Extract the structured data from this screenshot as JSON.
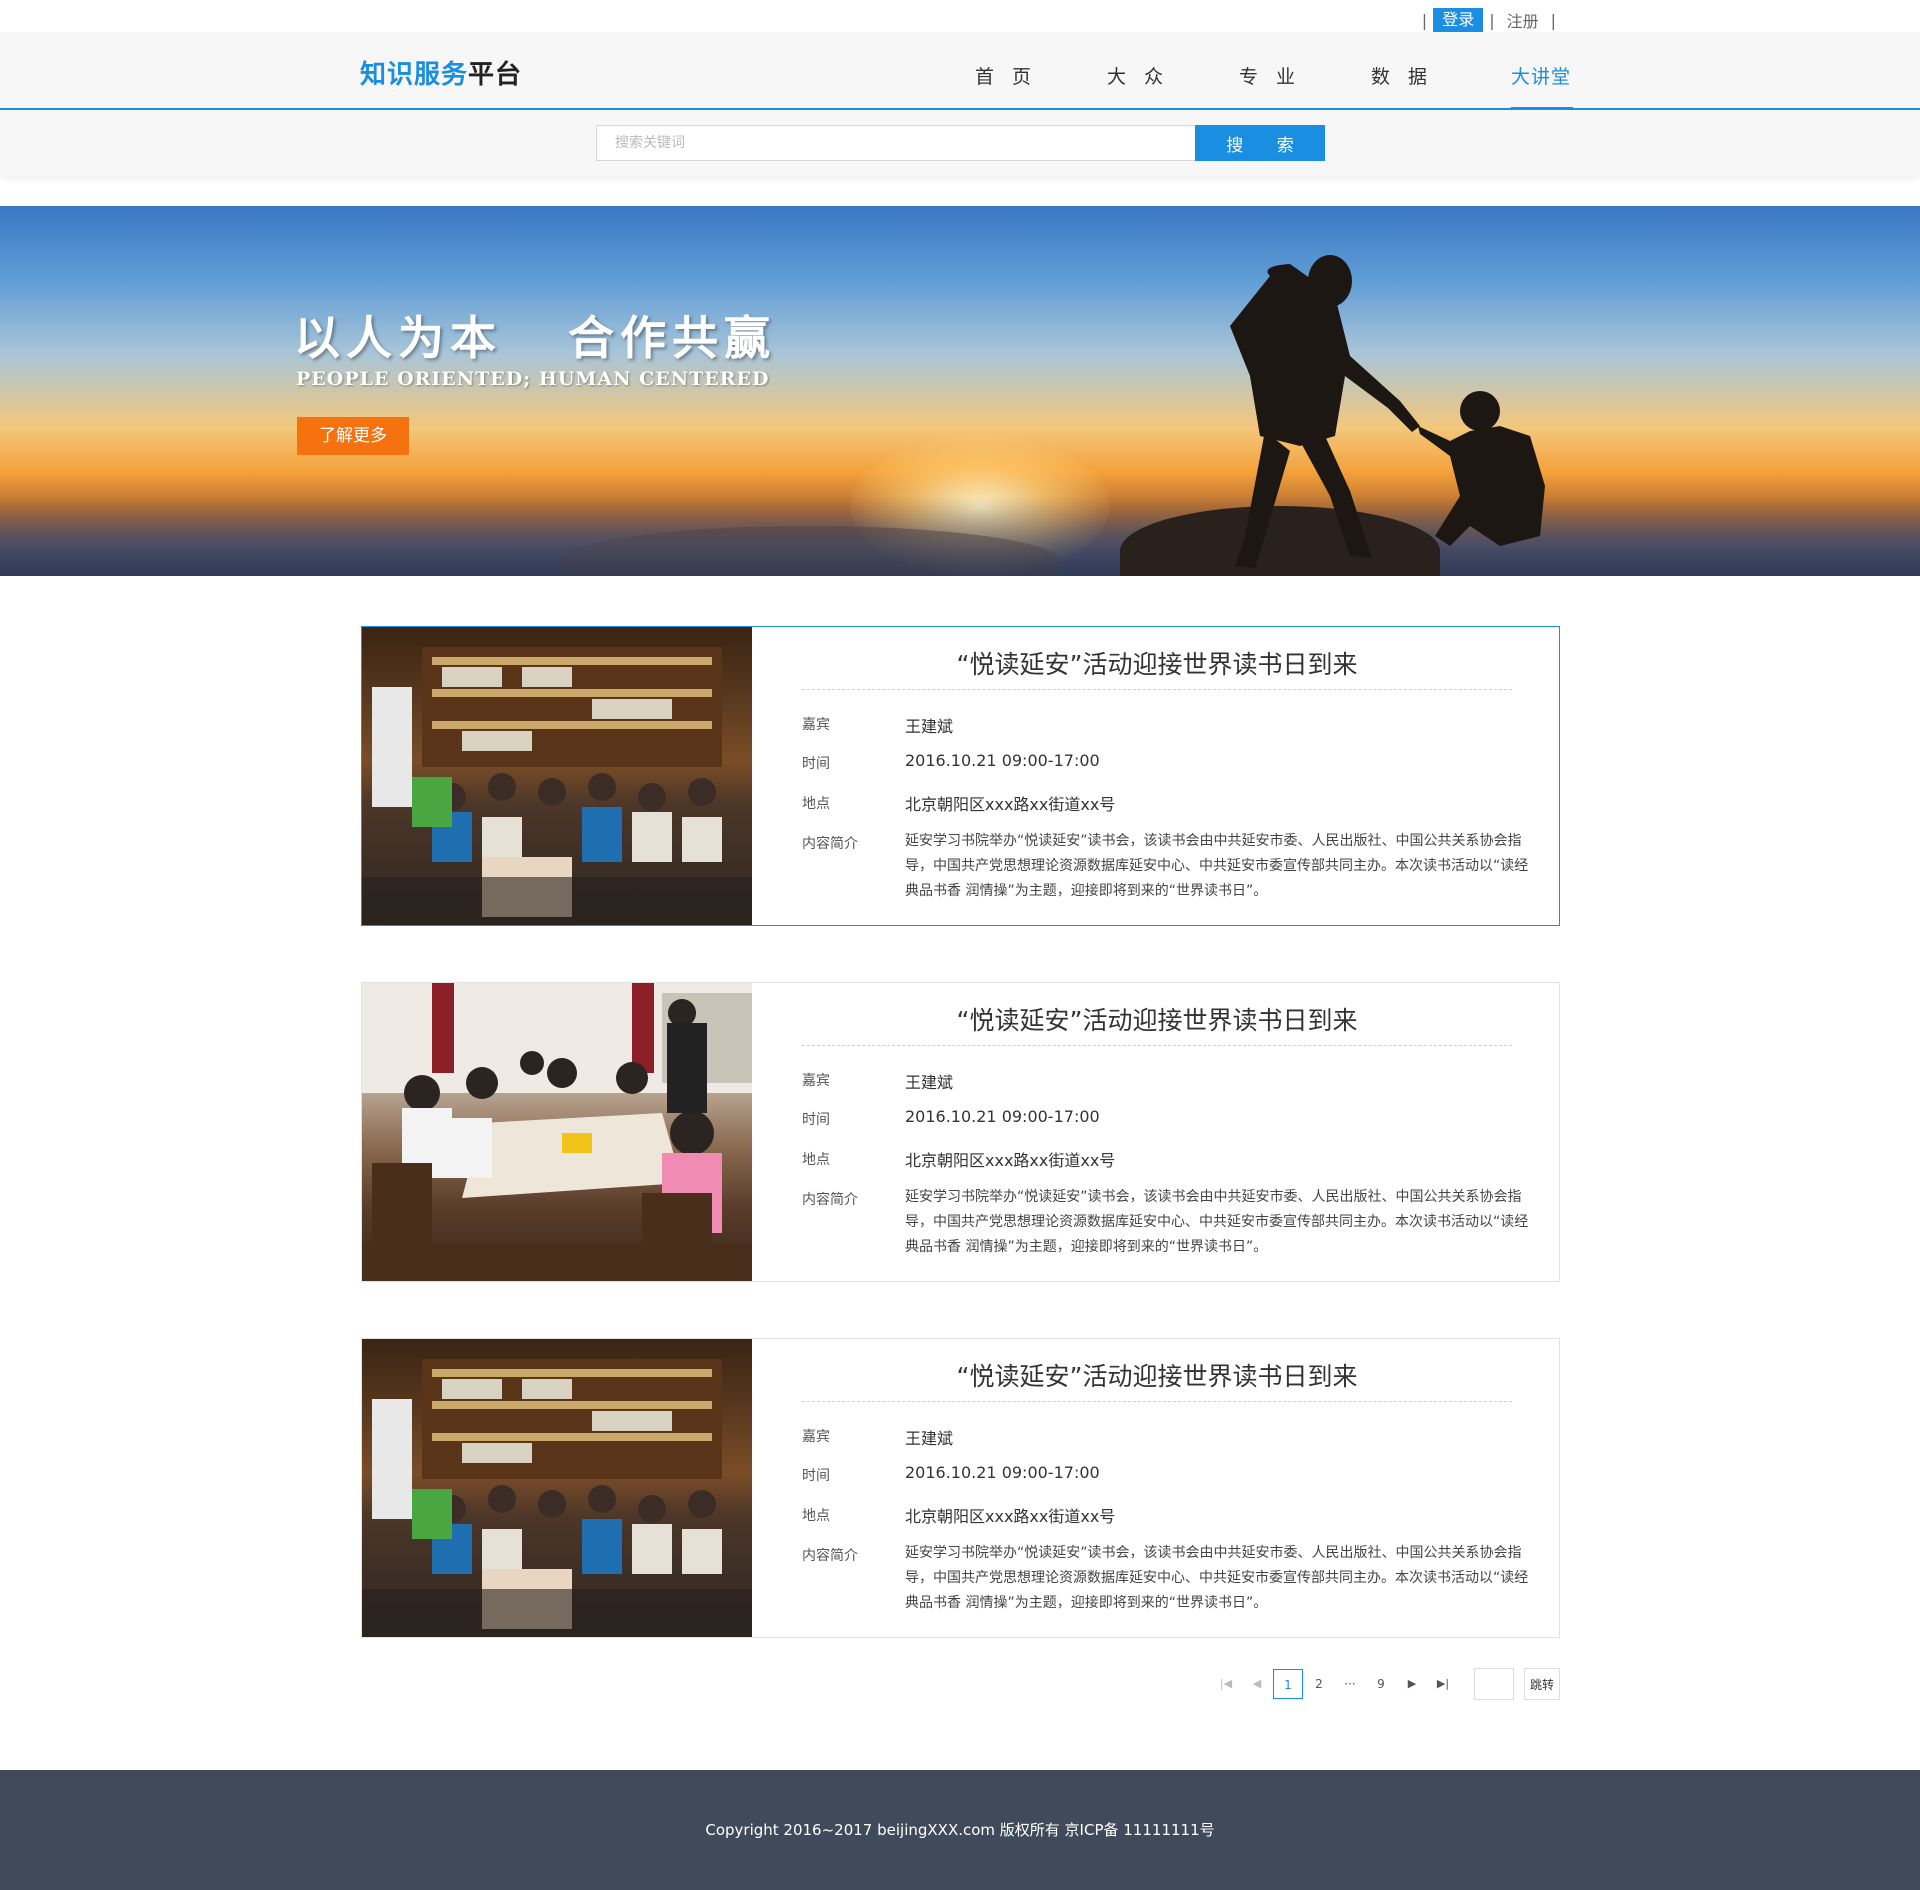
{
  "topbar": {
    "login": "登录",
    "register": "注册"
  },
  "header": {
    "logo_part1": "知识服务",
    "logo_part2": "平台",
    "nav": [
      {
        "label": "首页",
        "active": false
      },
      {
        "label": "大众",
        "active": false
      },
      {
        "label": "专业",
        "active": false
      },
      {
        "label": "数据",
        "active": false
      },
      {
        "label": "大讲堂",
        "active": true
      }
    ]
  },
  "search": {
    "placeholder": "搜索关键词",
    "button": "搜 索"
  },
  "banner": {
    "headline": "以人为本   合作共赢",
    "subline": "PEOPLE ORIENTED; HUMAN CENTERED",
    "button": "了解更多"
  },
  "events": [
    {
      "title": "“悦读延安”活动迎接世界读书日到来",
      "guest_label": "嘉宾",
      "guest": "王建斌",
      "time_label": "时间",
      "time": "2016.10.21   09:00-17:00",
      "place_label": "地点",
      "place": "北京朝阳区xxx路xx街道xx号",
      "intro_label": "内容简介",
      "intro": "延安学习书院举办“悦读延安”读书会，该读书会由中共延安市委、人民出版社、中国公共关系协会指导，中国共产党思想理论资源数据库延安中心、中共延安市委宣传部共同主办。本次读书活动以“读经典品书香 润情操”为主题，迎接即将到来的“世界读书日”。",
      "photo": "reading-session-bookshelf"
    },
    {
      "title": "“悦读延安”活动迎接世界读书日到来",
      "guest_label": "嘉宾",
      "guest": "王建斌",
      "time_label": "时间",
      "time": "2016.10.21   09:00-17:00",
      "place_label": "地点",
      "place": "北京朝阳区xxx路xx街道xx号",
      "intro_label": "内容简介",
      "intro": "延安学习书院举办“悦读延安”读书会，该读书会由中共延安市委、人民出版社、中国公共关系协会指导，中国共产党思想理论资源数据库延安中心、中共延安市委宣传部共同主办。本次读书活动以“读经典品书香 润情操”为主题，迎接即将到来的“世界读书日”。",
      "photo": "children-reading-table"
    },
    {
      "title": "“悦读延安”活动迎接世界读书日到来",
      "guest_label": "嘉宾",
      "guest": "王建斌",
      "time_label": "时间",
      "time": "2016.10.21   09:00-17:00",
      "place_label": "地点",
      "place": "北京朝阳区xxx路xx街道xx号",
      "intro_label": "内容简介",
      "intro": "延安学习书院举办“悦读延安”读书会，该读书会由中共延安市委、人民出版社、中国公共关系协会指导，中国共产党思想理论资源数据库延安中心、中共延安市委宣传部共同主办。本次读书活动以“读经典品书香 润情操”为主题，迎接即将到来的“世界读书日”。",
      "photo": "reading-session-bookshelf"
    }
  ],
  "pagination": {
    "first_icon": "first-page-icon",
    "prev_icon": "prev-page-icon",
    "next_icon": "next-page-icon",
    "last_icon": "last-page-icon",
    "pages": [
      "1",
      "2",
      "···",
      "9"
    ],
    "current": "1",
    "jump": "跳转"
  },
  "footer": {
    "copyright": "Copyright 2016~2017 beijingXXX.com 版权所有 京ICP备 11111111号"
  },
  "colors": {
    "accent": "#1a8ee0",
    "banner_button": "#f5720f",
    "footer_bg": "#3f4a5a"
  }
}
